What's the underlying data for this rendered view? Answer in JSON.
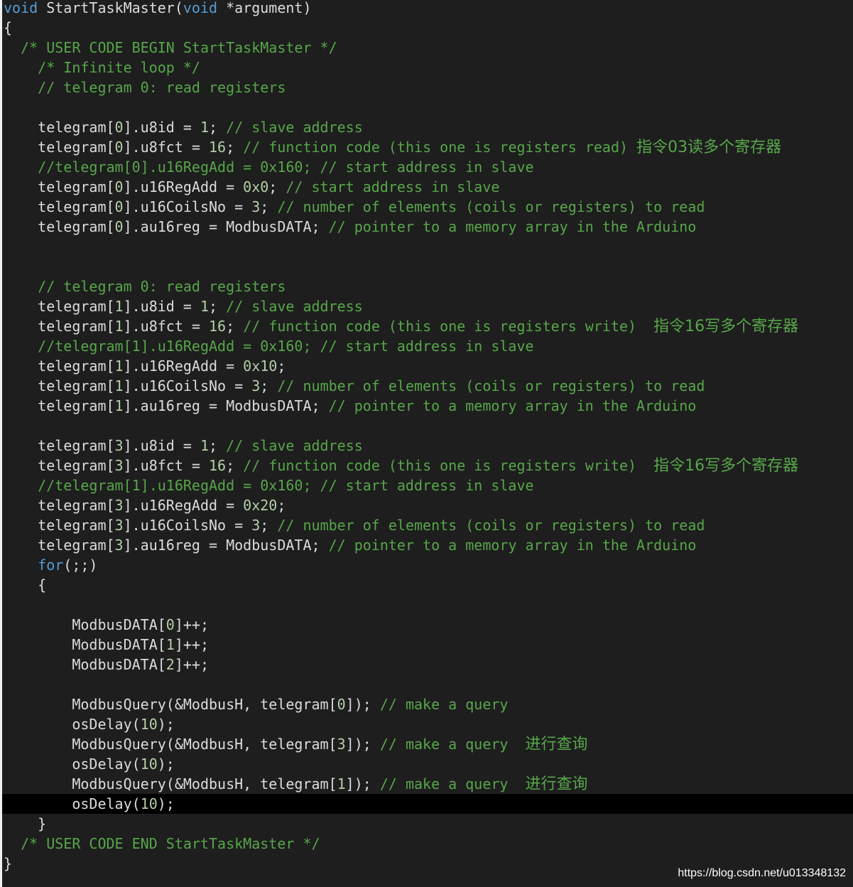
{
  "editor": {
    "lines": [
      {
        "indent": 0,
        "tokens": [
          {
            "t": "void",
            "c": "kw"
          },
          {
            "t": " StartTaskMaster(",
            "c": "pl"
          },
          {
            "t": "void",
            "c": "kw"
          },
          {
            "t": " *argument)",
            "c": "pl"
          }
        ]
      },
      {
        "indent": 0,
        "tokens": [
          {
            "t": "{",
            "c": "pl"
          }
        ]
      },
      {
        "indent": 2,
        "tokens": [
          {
            "t": "/* USER CODE BEGIN StartTaskMaster */",
            "c": "cm"
          }
        ]
      },
      {
        "indent": 4,
        "tokens": [
          {
            "t": "/* Infinite loop */",
            "c": "cm"
          }
        ]
      },
      {
        "indent": 4,
        "tokens": [
          {
            "t": "// telegram 0: read registers",
            "c": "cm"
          }
        ]
      },
      {
        "indent": 0,
        "tokens": []
      },
      {
        "indent": 4,
        "tokens": [
          {
            "t": "telegram[",
            "c": "pl"
          },
          {
            "t": "0",
            "c": "nm"
          },
          {
            "t": "].u8id = ",
            "c": "pl"
          },
          {
            "t": "1",
            "c": "nm"
          },
          {
            "t": "; ",
            "c": "pl"
          },
          {
            "t": "// slave address",
            "c": "cm"
          }
        ]
      },
      {
        "indent": 4,
        "tokens": [
          {
            "t": "telegram[",
            "c": "pl"
          },
          {
            "t": "0",
            "c": "nm"
          },
          {
            "t": "].u8fct = ",
            "c": "pl"
          },
          {
            "t": "16",
            "c": "nm"
          },
          {
            "t": "; ",
            "c": "pl"
          },
          {
            "t": "// function code (this one is registers read) ",
            "c": "cm"
          },
          {
            "t": "指令03读多个寄存器",
            "c": "cn"
          }
        ]
      },
      {
        "indent": 4,
        "tokens": [
          {
            "t": "//telegram[0].u16RegAdd = 0x160; // start address in slave",
            "c": "cm"
          }
        ]
      },
      {
        "indent": 4,
        "tokens": [
          {
            "t": "telegram[",
            "c": "pl"
          },
          {
            "t": "0",
            "c": "nm"
          },
          {
            "t": "].u16RegAdd = ",
            "c": "pl"
          },
          {
            "t": "0x0",
            "c": "nm"
          },
          {
            "t": "; ",
            "c": "pl"
          },
          {
            "t": "// start address in slave",
            "c": "cm"
          }
        ]
      },
      {
        "indent": 4,
        "tokens": [
          {
            "t": "telegram[",
            "c": "pl"
          },
          {
            "t": "0",
            "c": "nm"
          },
          {
            "t": "].u16CoilsNo = ",
            "c": "pl"
          },
          {
            "t": "3",
            "c": "nm"
          },
          {
            "t": "; ",
            "c": "pl"
          },
          {
            "t": "// number of elements (coils or registers) to read",
            "c": "cm"
          }
        ]
      },
      {
        "indent": 4,
        "tokens": [
          {
            "t": "telegram[",
            "c": "pl"
          },
          {
            "t": "0",
            "c": "nm"
          },
          {
            "t": "].au16reg = ModbusDATA; ",
            "c": "pl"
          },
          {
            "t": "// pointer to a memory array in the Arduino",
            "c": "cm"
          }
        ]
      },
      {
        "indent": 0,
        "tokens": []
      },
      {
        "indent": 0,
        "tokens": []
      },
      {
        "indent": 4,
        "tokens": [
          {
            "t": "// telegram 0: read registers",
            "c": "cm"
          }
        ]
      },
      {
        "indent": 4,
        "tokens": [
          {
            "t": "telegram[",
            "c": "pl"
          },
          {
            "t": "1",
            "c": "nm"
          },
          {
            "t": "].u8id = ",
            "c": "pl"
          },
          {
            "t": "1",
            "c": "nm"
          },
          {
            "t": "; ",
            "c": "pl"
          },
          {
            "t": "// slave address",
            "c": "cm"
          }
        ]
      },
      {
        "indent": 4,
        "tokens": [
          {
            "t": "telegram[",
            "c": "pl"
          },
          {
            "t": "1",
            "c": "nm"
          },
          {
            "t": "].u8fct = ",
            "c": "pl"
          },
          {
            "t": "16",
            "c": "nm"
          },
          {
            "t": "; ",
            "c": "pl"
          },
          {
            "t": "// function code (this one is registers write)  ",
            "c": "cm"
          },
          {
            "t": "指令16写多个寄存器",
            "c": "cn"
          }
        ]
      },
      {
        "indent": 4,
        "tokens": [
          {
            "t": "//telegram[1].u16RegAdd = 0x160; // start address in slave",
            "c": "cm"
          }
        ]
      },
      {
        "indent": 4,
        "tokens": [
          {
            "t": "telegram[",
            "c": "pl"
          },
          {
            "t": "1",
            "c": "nm"
          },
          {
            "t": "].u16RegAdd = ",
            "c": "pl"
          },
          {
            "t": "0x10",
            "c": "nm"
          },
          {
            "t": ";",
            "c": "pl"
          }
        ]
      },
      {
        "indent": 4,
        "tokens": [
          {
            "t": "telegram[",
            "c": "pl"
          },
          {
            "t": "1",
            "c": "nm"
          },
          {
            "t": "].u16CoilsNo = ",
            "c": "pl"
          },
          {
            "t": "3",
            "c": "nm"
          },
          {
            "t": "; ",
            "c": "pl"
          },
          {
            "t": "// number of elements (coils or registers) to read",
            "c": "cm"
          }
        ]
      },
      {
        "indent": 4,
        "tokens": [
          {
            "t": "telegram[",
            "c": "pl"
          },
          {
            "t": "1",
            "c": "nm"
          },
          {
            "t": "].au16reg = ModbusDATA; ",
            "c": "pl"
          },
          {
            "t": "// pointer to a memory array in the Arduino",
            "c": "cm"
          }
        ]
      },
      {
        "indent": 0,
        "tokens": []
      },
      {
        "indent": 4,
        "tokens": [
          {
            "t": "telegram[",
            "c": "pl"
          },
          {
            "t": "3",
            "c": "nm"
          },
          {
            "t": "].u8id = ",
            "c": "pl"
          },
          {
            "t": "1",
            "c": "nm"
          },
          {
            "t": "; ",
            "c": "pl"
          },
          {
            "t": "// slave address",
            "c": "cm"
          }
        ]
      },
      {
        "indent": 4,
        "tokens": [
          {
            "t": "telegram[",
            "c": "pl"
          },
          {
            "t": "3",
            "c": "nm"
          },
          {
            "t": "].u8fct = ",
            "c": "pl"
          },
          {
            "t": "16",
            "c": "nm"
          },
          {
            "t": "; ",
            "c": "pl"
          },
          {
            "t": "// function code (this one is registers write)  ",
            "c": "cm"
          },
          {
            "t": "指令16写多个寄存器",
            "c": "cn"
          }
        ]
      },
      {
        "indent": 4,
        "tokens": [
          {
            "t": "//telegram[1].u16RegAdd = 0x160; // start address in slave",
            "c": "cm"
          }
        ]
      },
      {
        "indent": 4,
        "tokens": [
          {
            "t": "telegram[",
            "c": "pl"
          },
          {
            "t": "3",
            "c": "nm"
          },
          {
            "t": "].u16RegAdd = ",
            "c": "pl"
          },
          {
            "t": "0x20",
            "c": "nm"
          },
          {
            "t": ";",
            "c": "pl"
          }
        ]
      },
      {
        "indent": 4,
        "tokens": [
          {
            "t": "telegram[",
            "c": "pl"
          },
          {
            "t": "3",
            "c": "nm"
          },
          {
            "t": "].u16CoilsNo = ",
            "c": "pl"
          },
          {
            "t": "3",
            "c": "nm"
          },
          {
            "t": "; ",
            "c": "pl"
          },
          {
            "t": "// number of elements (coils or registers) to read",
            "c": "cm"
          }
        ]
      },
      {
        "indent": 4,
        "tokens": [
          {
            "t": "telegram[",
            "c": "pl"
          },
          {
            "t": "3",
            "c": "nm"
          },
          {
            "t": "].au16reg = ModbusDATA; ",
            "c": "pl"
          },
          {
            "t": "// pointer to a memory array in the Arduino",
            "c": "cm"
          }
        ]
      },
      {
        "indent": 4,
        "tokens": [
          {
            "t": "for",
            "c": "kw"
          },
          {
            "t": "(;;)",
            "c": "pl"
          }
        ]
      },
      {
        "indent": 4,
        "tokens": [
          {
            "t": "{",
            "c": "pl"
          }
        ]
      },
      {
        "indent": 0,
        "tokens": []
      },
      {
        "indent": 8,
        "tokens": [
          {
            "t": "ModbusDATA[",
            "c": "pl"
          },
          {
            "t": "0",
            "c": "nm"
          },
          {
            "t": "]++;",
            "c": "pl"
          }
        ]
      },
      {
        "indent": 8,
        "tokens": [
          {
            "t": "ModbusDATA[",
            "c": "pl"
          },
          {
            "t": "1",
            "c": "nm"
          },
          {
            "t": "]++;",
            "c": "pl"
          }
        ]
      },
      {
        "indent": 8,
        "tokens": [
          {
            "t": "ModbusDATA[",
            "c": "pl"
          },
          {
            "t": "2",
            "c": "nm"
          },
          {
            "t": "]++;",
            "c": "pl"
          }
        ]
      },
      {
        "indent": 0,
        "tokens": []
      },
      {
        "indent": 8,
        "tokens": [
          {
            "t": "ModbusQuery(&ModbusH, telegram[",
            "c": "pl"
          },
          {
            "t": "0",
            "c": "nm"
          },
          {
            "t": "]); ",
            "c": "pl"
          },
          {
            "t": "// make a query",
            "c": "cm"
          }
        ]
      },
      {
        "indent": 8,
        "tokens": [
          {
            "t": "osDelay(",
            "c": "pl"
          },
          {
            "t": "10",
            "c": "nm"
          },
          {
            "t": ");",
            "c": "pl"
          }
        ]
      },
      {
        "indent": 8,
        "tokens": [
          {
            "t": "ModbusQuery(&ModbusH, telegram[",
            "c": "pl"
          },
          {
            "t": "3",
            "c": "nm"
          },
          {
            "t": "]); ",
            "c": "pl"
          },
          {
            "t": "// make a query  ",
            "c": "cm"
          },
          {
            "t": "进行查询",
            "c": "cn"
          }
        ]
      },
      {
        "indent": 8,
        "tokens": [
          {
            "t": "osDelay(",
            "c": "pl"
          },
          {
            "t": "10",
            "c": "nm"
          },
          {
            "t": ");",
            "c": "pl"
          }
        ]
      },
      {
        "indent": 8,
        "tokens": [
          {
            "t": "ModbusQuery(&ModbusH, telegram[",
            "c": "pl"
          },
          {
            "t": "1",
            "c": "nm"
          },
          {
            "t": "]); ",
            "c": "pl"
          },
          {
            "t": "// make a query  ",
            "c": "cm"
          },
          {
            "t": "进行查询",
            "c": "cn"
          }
        ]
      },
      {
        "indent": 8,
        "current": true,
        "tokens": [
          {
            "t": "osDelay(",
            "c": "pl"
          },
          {
            "t": "10",
            "c": "nm"
          },
          {
            "t": ");",
            "c": "pl"
          }
        ]
      },
      {
        "indent": 4,
        "tokens": [
          {
            "t": "}",
            "c": "pl"
          }
        ]
      },
      {
        "indent": 2,
        "tokens": [
          {
            "t": "/* USER CODE END StartTaskMaster */",
            "c": "cm"
          }
        ]
      },
      {
        "indent": 0,
        "tokens": [
          {
            "t": "}",
            "c": "pl"
          }
        ]
      }
    ]
  },
  "watermark": "https://blog.csdn.net/u013348132",
  "colors": {
    "background": "#1e1e1e",
    "keyword": "#569cd6",
    "plain": "#dcdcdc",
    "number": "#b5cea8",
    "comment": "#57a64a",
    "current_line": "#000000"
  }
}
